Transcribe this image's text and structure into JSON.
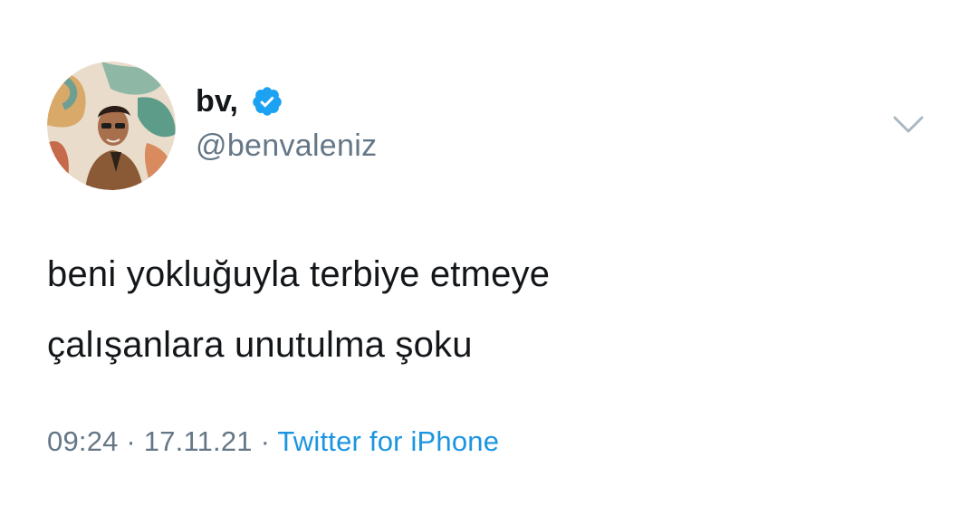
{
  "author": {
    "display_name": "bv,",
    "handle": "@benvaleniz",
    "verified": true,
    "avatar_icon": "profile-photo"
  },
  "tweet": {
    "text_lines": [
      "beni yokluğuyla terbiye etmeye",
      "çalışanlara unutulma şoku"
    ]
  },
  "meta": {
    "time": "09:24",
    "separator": "·",
    "date": "17.11.21",
    "source": "Twitter for iPhone"
  },
  "colors": {
    "text": "#14171a",
    "secondary": "#657786",
    "link": "#1b95e0",
    "verified": "#1da1f2",
    "chevron": "#aab8c2"
  },
  "icons": {
    "verified": "verified-badge-icon",
    "more": "chevron-down-icon"
  }
}
